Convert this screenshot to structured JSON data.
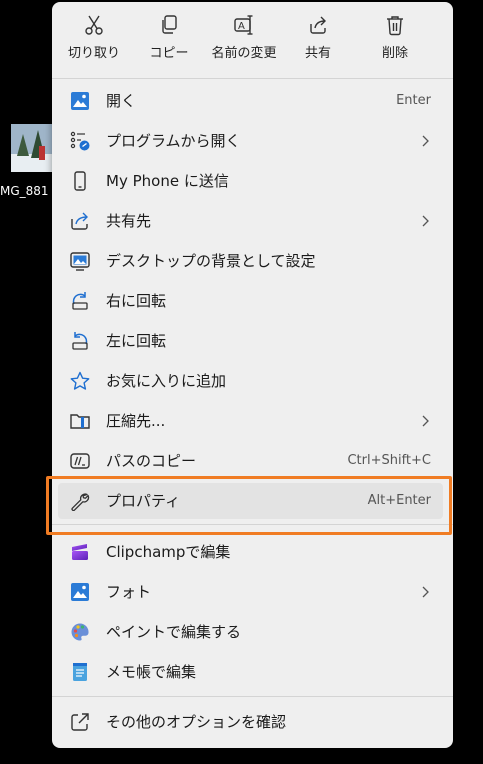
{
  "desktop": {
    "file_label": "MG_881"
  },
  "toolbar": [
    {
      "label": "切り取り",
      "icon": "scissors-icon"
    },
    {
      "label": "コピー",
      "icon": "copy-icon"
    },
    {
      "label": "名前の変更",
      "icon": "rename-icon"
    },
    {
      "label": "共有",
      "icon": "share-icon"
    },
    {
      "label": "削除",
      "icon": "trash-icon"
    }
  ],
  "items": [
    {
      "label": "開く",
      "shortcut": "Enter",
      "icon": "photo-app-icon"
    },
    {
      "label": "プログラムから開く",
      "icon": "open-with-icon",
      "submenu": true
    },
    {
      "label": "My Phone に送信",
      "icon": "phone-icon"
    },
    {
      "label": "共有先",
      "icon": "share-icon",
      "submenu": true
    },
    {
      "label": "デスクトップの背景として設定",
      "icon": "wallpaper-icon"
    },
    {
      "label": "右に回転",
      "icon": "rotate-right-icon"
    },
    {
      "label": "左に回転",
      "icon": "rotate-left-icon"
    },
    {
      "label": "お気に入りに追加",
      "icon": "star-icon"
    },
    {
      "label": "圧縮先...",
      "icon": "zip-folder-icon",
      "submenu": true
    },
    {
      "label": "パスのコピー",
      "shortcut": "Ctrl+Shift+C",
      "icon": "copy-path-icon"
    },
    {
      "label": "プロパティ",
      "shortcut": "Alt+Enter",
      "icon": "wrench-icon",
      "highlighted": true
    },
    {
      "label": "Clipchampで編集",
      "icon": "clipchamp-icon"
    },
    {
      "label": "フォト",
      "icon": "photos-icon",
      "submenu": true
    },
    {
      "label": "ペイントで編集する",
      "icon": "paint-icon"
    },
    {
      "label": "メモ帳で編集",
      "icon": "notepad-icon"
    },
    {
      "label": "その他のオプションを確認",
      "icon": "more-options-icon"
    }
  ],
  "colors": {
    "highlight_border": "#f07c23",
    "menu_bg": "#efefef",
    "accent": "#1f6fd0"
  }
}
